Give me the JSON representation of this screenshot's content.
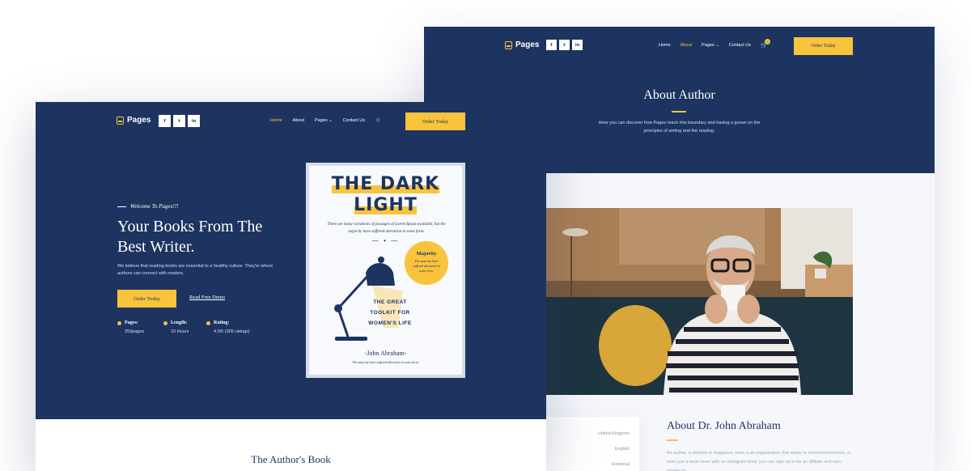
{
  "colors": {
    "navy": "#1d3461",
    "accent": "#f9c33c",
    "light_bg": "#f6f7fb"
  },
  "about_page": {
    "logo": "Pages",
    "social": [
      "f",
      "t",
      "in"
    ],
    "nav": [
      "Home",
      "About",
      "Pages",
      "Contact Us"
    ],
    "active_nav": "About",
    "cart_count": "0",
    "order_button": "Order Today",
    "title": "About Author",
    "subtitle": "Here you can discover how Pages reach this boundary and having a grown on the principles of writing and the reading.",
    "info_items": [
      "United Kingdom",
      "English",
      "Historical"
    ],
    "about_heading": "About Dr. John Abraham",
    "about_text": "An author, a website or magazine, have a an organization that wants to recommend books, or even just a book-lover with an Instagram feed, you can sign up to be an affiliate and earn money by"
  },
  "home_page": {
    "logo": "Pages",
    "social": [
      "f",
      "t",
      "in"
    ],
    "nav": [
      "Home",
      "About",
      "Pages",
      "Contact Us"
    ],
    "active_nav": "Home",
    "order_button": "Order Today",
    "welcome": "Welcome To Pages!!!",
    "hero_title": "Your Books From The Best Writer.",
    "hero_desc": "We believe that reading books are essential to a healthy culture. They're where authors can connect with readers.",
    "cta_button": "Order Today",
    "demo_link": "Read Free Demo",
    "stats": [
      {
        "label": "Pages:",
        "value": "250pages"
      },
      {
        "label": "Length:",
        "value": "10 Hours"
      },
      {
        "label": "Rating:",
        "value": "4.5/5 (305 ratings)"
      }
    ],
    "section_title": "The Author's Book"
  },
  "book": {
    "title_line1": "THE DARK",
    "title_line2": "LIGHT",
    "desc": "There are many variations of passages of Lorem Ipsum available, but the majority have suffered alteration in some form.",
    "badge_title": "Majority",
    "badge_text": "The majority have suffered alteration in some form.",
    "tagline": "THE GREAT TOOLKIT FOR WOMEN'S LIFE",
    "author": "-John Abraham-",
    "footer": "The majority have suffered alteration in some form."
  }
}
